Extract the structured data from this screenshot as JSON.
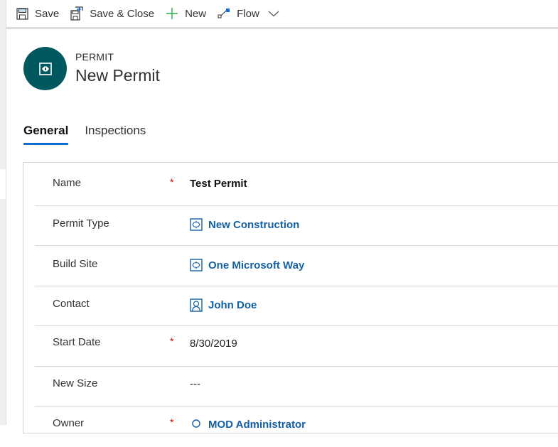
{
  "commandbar": {
    "save": "Save",
    "save_close": "Save & Close",
    "new": "New",
    "flow": "Flow"
  },
  "header": {
    "entity_type": "PERMIT",
    "title": "New Permit"
  },
  "tabs": [
    {
      "label": "General",
      "active": true
    },
    {
      "label": "Inspections",
      "active": false
    }
  ],
  "fields": [
    {
      "label": "Name",
      "required": "*",
      "value": "Test Permit"
    },
    {
      "label": "Permit Type",
      "required": "",
      "value": "New Construction",
      "icon": "entity-record-icon"
    },
    {
      "label": "Build Site",
      "required": "",
      "value": "One Microsoft Way",
      "icon": "entity-record-icon"
    },
    {
      "label": "Contact",
      "required": "",
      "value": "John Doe",
      "icon": "contact-icon"
    },
    {
      "label": "Start Date",
      "required": "*",
      "value": "8/30/2019"
    },
    {
      "label": "New Size",
      "required": "",
      "value": "---"
    },
    {
      "label": "Owner",
      "required": "*",
      "value": "MOD Administrator",
      "icon": "user-icon"
    }
  ],
  "colors": {
    "accent": "#0f6cd3",
    "avatar": "#02585f",
    "link": "#1460a4",
    "required": "#e00000"
  }
}
